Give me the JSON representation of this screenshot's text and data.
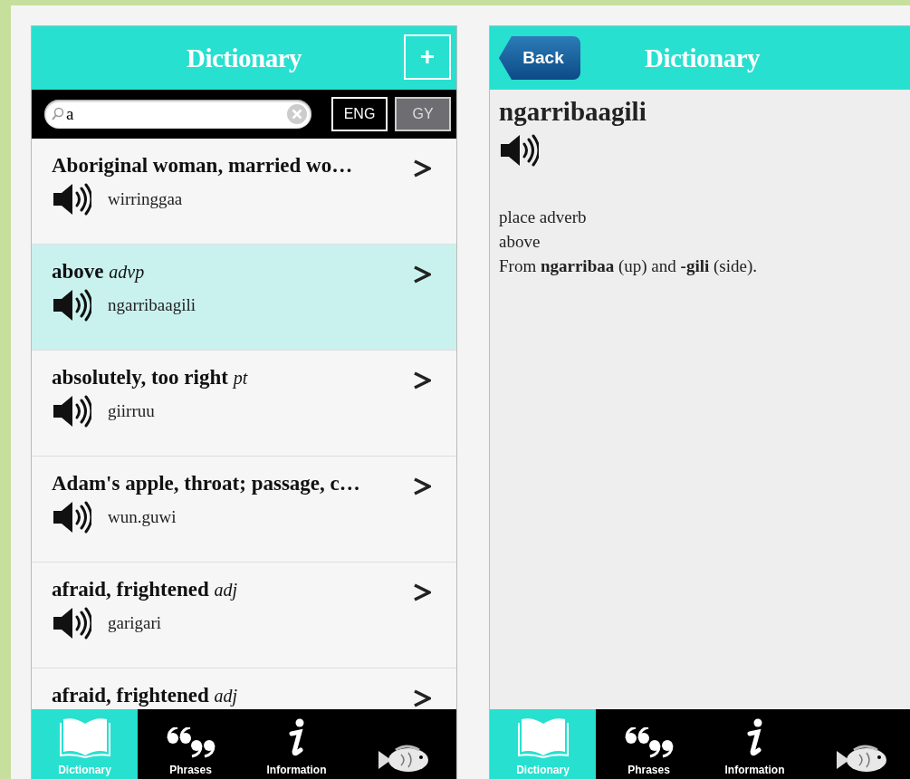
{
  "list_screen": {
    "header": {
      "title": "Dictionary",
      "add_button": "+"
    },
    "search": {
      "value": "a"
    },
    "languages": [
      {
        "label": "ENG",
        "selected": true
      },
      {
        "label": "GY",
        "selected": false
      }
    ],
    "entries": [
      {
        "headword": "Aboriginal woman, married wo…",
        "translation": "wirringgaa",
        "selected": false
      },
      {
        "headword": "above",
        "pos": "advp",
        "translation": "ngarribaagili",
        "selected": true
      },
      {
        "headword": "absolutely, too right",
        "pos": "pt",
        "translation": "giirruu",
        "selected": false
      },
      {
        "headword": "Adam's apple, throat; passage, c…",
        "translation": "wun.guwi",
        "selected": false
      },
      {
        "headword": "afraid, frightened",
        "pos": "adj",
        "translation": "garigari",
        "selected": false
      },
      {
        "headword": "afraid, frightened",
        "pos": "adj",
        "selected": false
      }
    ],
    "tabs": [
      {
        "kind": "book",
        "label": "Dictionary",
        "selected": true
      },
      {
        "kind": "quotes",
        "label": "Phrases",
        "selected": false
      },
      {
        "kind": "info",
        "label": "Information",
        "selected": false
      },
      {
        "kind": "fish",
        "selected": false
      }
    ]
  },
  "detail_screen": {
    "header": {
      "title": "Dictionary",
      "back_button": "Back"
    },
    "headword": "ngarribaagili",
    "lines": [
      "place adverb",
      "above",
      "From **ngarribaa** (up) and **-gili** (side)."
    ],
    "tabs": [
      {
        "kind": "book",
        "label": "Dictionary",
        "selected": true
      },
      {
        "kind": "quotes",
        "label": "Phrases",
        "selected": false
      },
      {
        "kind": "info",
        "label": "Information",
        "selected": false
      },
      {
        "kind": "fish",
        "selected": false
      }
    ]
  }
}
